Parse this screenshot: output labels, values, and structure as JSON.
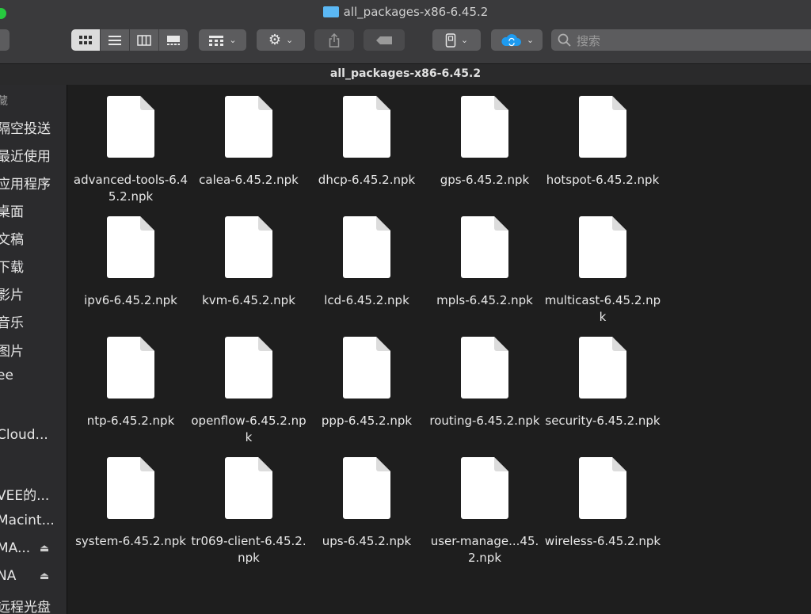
{
  "window": {
    "title": "all_packages-x86-6.45.2",
    "path_title": "all_packages-x86-6.45.2"
  },
  "toolbar": {
    "view_modes": [
      "icon-view",
      "list-view",
      "column-view",
      "gallery-view"
    ],
    "active_view": "icon-view",
    "search_placeholder": "搜索",
    "icons": {
      "group": "grid-group-icon",
      "action": "gear-icon",
      "share": "share-icon",
      "tag": "tag-icon",
      "disk": "disk-icon",
      "cloud": "icloud-icon"
    }
  },
  "sidebar": {
    "items": [
      {
        "label": "藏"
      },
      {
        "label": "隔空投送"
      },
      {
        "label": "最近使用"
      },
      {
        "label": "应用程序"
      },
      {
        "label": "桌面"
      },
      {
        "label": "文稿"
      },
      {
        "label": "下载"
      },
      {
        "label": "影片"
      },
      {
        "label": "音乐"
      },
      {
        "label": "图片"
      },
      {
        "label": "ee"
      },
      {
        "label": "Cloud..."
      },
      {
        "label": "VEE的..."
      },
      {
        "label": "Macint..."
      },
      {
        "label": "MA..."
      },
      {
        "label": "NA"
      },
      {
        "label": "远程光盘"
      }
    ]
  },
  "files": [
    {
      "name": "advanced-tools-6.45.2.npk"
    },
    {
      "name": "calea-6.45.2.npk"
    },
    {
      "name": "dhcp-6.45.2.npk"
    },
    {
      "name": "gps-6.45.2.npk"
    },
    {
      "name": "hotspot-6.45.2.npk"
    },
    {
      "name": "ipv6-6.45.2.npk"
    },
    {
      "name": "kvm-6.45.2.npk"
    },
    {
      "name": "lcd-6.45.2.npk"
    },
    {
      "name": "mpls-6.45.2.npk"
    },
    {
      "name": "multicast-6.45.2.npk"
    },
    {
      "name": "ntp-6.45.2.npk"
    },
    {
      "name": "openflow-6.45.2.npk"
    },
    {
      "name": "ppp-6.45.2.npk"
    },
    {
      "name": "routing-6.45.2.npk"
    },
    {
      "name": "security-6.45.2.npk"
    },
    {
      "name": "system-6.45.2.npk"
    },
    {
      "name": "tr069-client-6.45.2.npk"
    },
    {
      "name": "ups-6.45.2.npk"
    },
    {
      "name": "user-manage...45.2.npk"
    },
    {
      "name": "wireless-6.45.2.npk"
    }
  ],
  "colors": {
    "accent": "#27c93f",
    "folder": "#5bb8f5",
    "cloud": "#1e9bf0"
  }
}
